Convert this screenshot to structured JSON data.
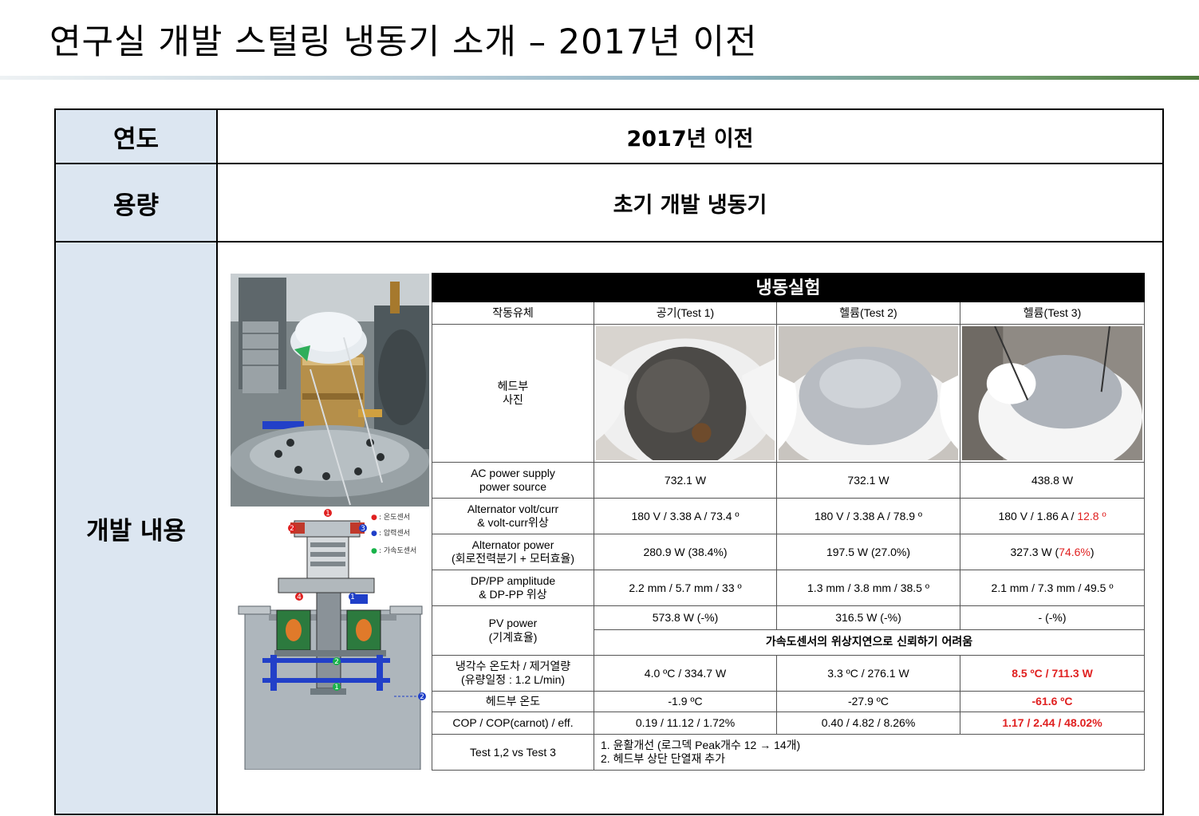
{
  "slide": {
    "title": "연구실 개발 스털링 냉동기 소개 – 2017년 이전"
  },
  "table": {
    "rows": [
      {
        "label": "연도",
        "value": "2017년 이전"
      },
      {
        "label": "용량",
        "value": "초기 개발 냉동기"
      },
      {
        "label": "개발 내용"
      }
    ]
  },
  "diagram": {
    "legend": [
      {
        "marker": "●",
        "text": ": 온도센서",
        "color": "#e02020"
      },
      {
        "marker": "●",
        "text": ": 압력센서",
        "color": "#1f3fc8"
      },
      {
        "marker": "●",
        "text": ": 가속도센서",
        "color": "#19b34a"
      }
    ],
    "markers": [
      "1",
      "2",
      "3",
      "4",
      "1",
      "2",
      "1",
      "2"
    ]
  },
  "experiment": {
    "title": "냉동실험",
    "column_headers": [
      "작동유체",
      "공기(Test 1)",
      "헬륨(Test 2)",
      "헬륨(Test 3)"
    ],
    "photo_row_label": "헤드부\n사진",
    "rows": [
      {
        "label": "AC power supply\npower source",
        "values": [
          "732.1 W",
          "732.1 W",
          "438.8 W"
        ]
      },
      {
        "label": "Alternator volt/curr\n& volt-curr위상",
        "values": [
          "180 V / 3.38 A / 73.4 º",
          "180 V / 3.38 A / 78.9 º"
        ],
        "test3_prefix": "180 V / 1.86 A / ",
        "test3_highlight": "12.8 º"
      },
      {
        "label": "Alternator power\n(회로전력분기 + 모터효율)",
        "values": [
          "280.9 W (38.4%)",
          "197.5 W (27.0%)"
        ],
        "test3_prefix": "327.3 W (",
        "test3_highlight": "74.6%",
        "test3_suffix": ")"
      },
      {
        "label": "DP/PP amplitude\n& DP-PP 위상",
        "values": [
          "2.2 mm / 5.7 mm / 33 º",
          "1.3 mm / 3.8 mm / 38.5 º",
          "2.1 mm / 7.3 mm / 49.5 º"
        ]
      },
      {
        "label": "PV power\n(기계효율)",
        "values": [
          "573.8 W (-%)",
          "316.5 W (-%)",
          "-  (-%)"
        ],
        "note": "가속도센서의 위상지연으로 신뢰하기 어려움"
      },
      {
        "label": "냉각수 온도차 / 제거열량\n(유량일정 : 1.2 L/min)",
        "values": [
          "4.0 ºC / 334.7 W",
          "3.3 ºC / 276.1 W",
          "8.5 ºC / 711.3 W"
        ]
      },
      {
        "label": "헤드부 온도",
        "values": [
          "-1.9 ºC",
          "-27.9 ºC",
          "-61.6 ºC"
        ]
      },
      {
        "label": "COP / COP(carnot) / eff.",
        "values": [
          "0.19 / 11.12 / 1.72%",
          "0.40 / 4.82 / 8.26%",
          "1.17 / 2.44 / 48.02%"
        ]
      },
      {
        "label": "Test 1,2 vs Test 3",
        "notes": [
          "1. 윤활개선 (로그덱 Peak개수 12 → 14개)",
          "2. 헤드부 상단 단열재 추가"
        ]
      }
    ]
  },
  "colors": {
    "label_bg": "#dce6f1",
    "highlight": "#e02020",
    "header_bg": "#000000"
  }
}
